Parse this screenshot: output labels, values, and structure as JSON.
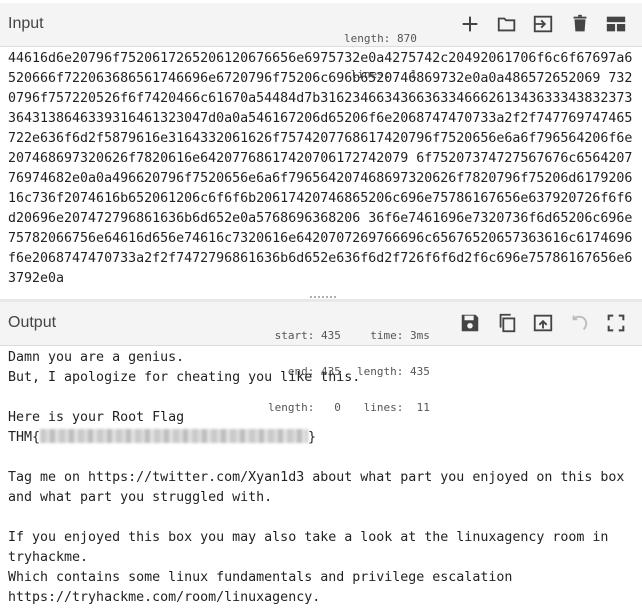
{
  "input": {
    "title": "Input",
    "stats": {
      "length_label": "length:",
      "length": "870",
      "lines_label": "lines:",
      "lines": "1"
    },
    "value": "44616d6e20796f7520617265206120676656e6975732e0a4275742c20492061706f6c6f67697a6520666f722063686561746696e6720796f75206c696b6520746869732e0a0a486572652069 7320796f757220526f6f7420466c61670a54484d7b3162346634366363346662613436333438323733643138646339316461323047d0a0a546167206d65206f6e2068747470733a2f2f747769747465722e636f6d2f5879616e3164332061626f7574207768617420796f7520656e6a6f796564206f6e207468697320626f7820616e64207768617420706172742079 6f75207374727567676c656420776974682e0a0a496620796f7520656e6a6f796564207468697320626f7820796f75206d617920616c736f2074616b652061206c6f6f6b20617420746865206c696e75786167656e637920726f6f6d20696e207472796861636b6d652e0a5768696368206 36f6e7461696e7320736f6d65206c696e75782066756e64616d656e74616c7320616e6420707269766696c65676520657363616c6174696f6e2068747470733a2f2f7472796861636b6d652e636f6d2f726f6f6d2f6c696e75786167656e63792e0a"
  },
  "output": {
    "title": "Output",
    "stats": {
      "start_label": "start:",
      "start": "435",
      "end_label": "end:",
      "end": "435",
      "length_label": "length:",
      "length": "0",
      "time_label": "time:",
      "time": "3ms",
      "olength_label": "length:",
      "olength": "435",
      "lines_label": "lines:",
      "lines": "11"
    },
    "lines": {
      "l1": "Damn you are a genius.",
      "l2": "But, I apologize for cheating you like this.",
      "l3": "",
      "l4": "Here is your Root Flag",
      "flag_prefix": "THM{",
      "flag_suffix": "}",
      "l6": "",
      "l7": "Tag me on https://twitter.com/Xyan1d3 about what part you enjoyed on this box and what part you struggled with.",
      "l8": "",
      "l9": "If you enjoyed this box you may also take a look at the linuxagency room in tryhackme.",
      "l10": "Which contains some linux fundamentals and privilege escalation",
      "l11": "https://tryhackme.com/room/linuxagency."
    }
  },
  "icons": {
    "input": [
      "plus-icon",
      "folder-open-icon",
      "import-file-icon",
      "trash-icon",
      "layout-icon"
    ],
    "output": [
      "save-icon",
      "copy-icon",
      "replace-input-icon",
      "undo-icon",
      "maximize-icon"
    ]
  },
  "colors": {
    "icon": "#444444",
    "header_bg": "#f4f4f4",
    "disabled_icon": "#bbbbbb"
  }
}
